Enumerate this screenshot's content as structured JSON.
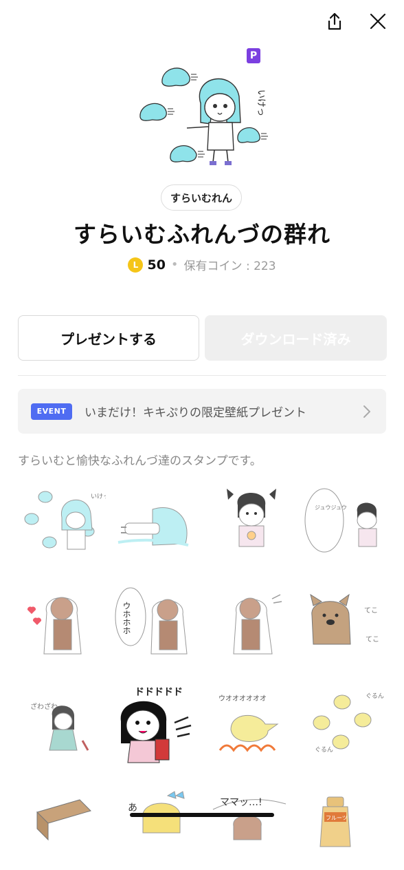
{
  "header": {
    "share_icon": "share-icon",
    "close_icon": "close-icon"
  },
  "product": {
    "premium_badge": "P",
    "author": "すらいむれん",
    "title": "すらいむふれんづの群れ",
    "coin_letter": "L",
    "price": "50",
    "owned_coins": "保有コイン : 223"
  },
  "buttons": {
    "present": "プレゼントする",
    "download": "ダウンロード済み"
  },
  "event": {
    "badge": "EVENT",
    "text": "いまだけ！キキぷりの限定壁紙プレゼント"
  },
  "description": "すらいむと愉快なふれんづ達のスタンプです。",
  "hero_text": "いけっ",
  "stickers": [
    {
      "text": "いけっ"
    },
    {
      "text": ""
    },
    {
      "text": ""
    },
    {
      "text": "ジュウジュウ"
    },
    {
      "text": ""
    },
    {
      "text": "ウホホホ"
    },
    {
      "text": ""
    },
    {
      "text": "てこ"
    },
    {
      "text": "ざわざわ"
    },
    {
      "text": "ドドドドド"
    },
    {
      "text": "ウオオオオオオ"
    },
    {
      "text": "ぐるん"
    },
    {
      "text": ""
    },
    {
      "text": "あ"
    },
    {
      "text": "ママッ…!"
    },
    {
      "text": "フルーツ"
    }
  ],
  "colors": {
    "accent_blue": "#4f6cf2",
    "premium_purple": "#7b3fe0",
    "coin": "#f5c518",
    "slime": "#8fe3ea"
  }
}
